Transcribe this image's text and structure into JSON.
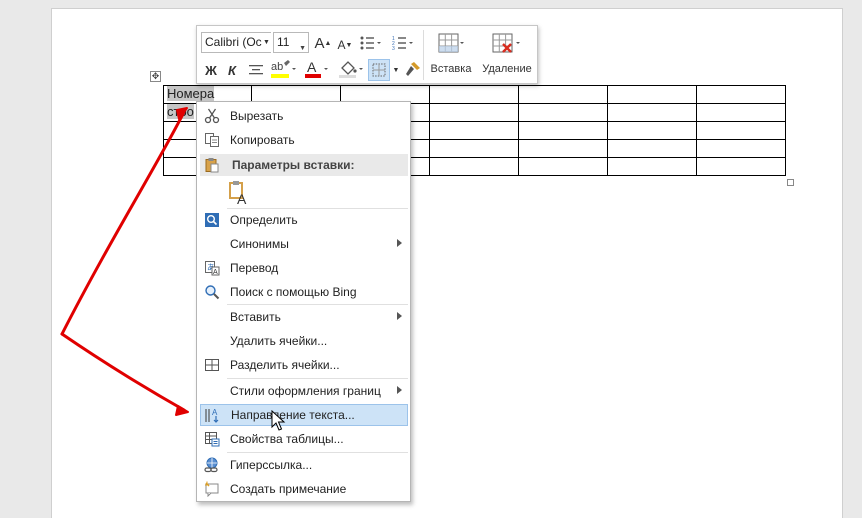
{
  "table": {
    "cell_line1": "Номера",
    "cell_line2": "стро"
  },
  "minibar": {
    "font_name": "Calibri (Ос",
    "font_size": "11",
    "grow_font": "A",
    "shrink_font": "A",
    "bold": "Ж",
    "italic": "К",
    "font_color_letter": "A",
    "insert_label": "Вставка",
    "delete_label": "Удаление"
  },
  "context_menu": {
    "cut": "Вырезать",
    "copy": "Копировать",
    "paste_options": "Параметры вставки:",
    "paste_keep_letter": "A",
    "define": "Определить",
    "synonyms": "Синонимы",
    "translate": "Перевод",
    "bing_search": "Поиск с помощью Bing",
    "insert": "Вставить",
    "delete_cells": "Удалить ячейки...",
    "split_cells": "Разделить ячейки...",
    "border_styles": "Стили оформления границ",
    "text_direction": "Направление текста...",
    "table_properties": "Свойства таблицы...",
    "hyperlink": "Гиперссылка...",
    "new_comment": "Создать примечание"
  },
  "colors": {
    "highlight": "#cde3f7",
    "arrow": "#e00000",
    "font_color_bar": "#e00000",
    "highlighter_bar": "#ffff00"
  },
  "icons": [
    "move-table-icon",
    "grow-font-icon",
    "shrink-font-icon",
    "bullets-icon",
    "numbering-icon",
    "bold-icon",
    "italic-icon",
    "center-icon",
    "highlighter-icon",
    "font-color-icon",
    "shading-icon",
    "borders-icon",
    "format-painter-icon",
    "insert-table-icon",
    "delete-table-icon",
    "scissors-icon",
    "copy-icon",
    "clipboard-icon",
    "define-icon",
    "translate-icon",
    "search-icon",
    "split-cells-icon",
    "text-direction-icon",
    "table-properties-icon",
    "hyperlink-icon",
    "comment-icon",
    "mouse-cursor-icon"
  ]
}
